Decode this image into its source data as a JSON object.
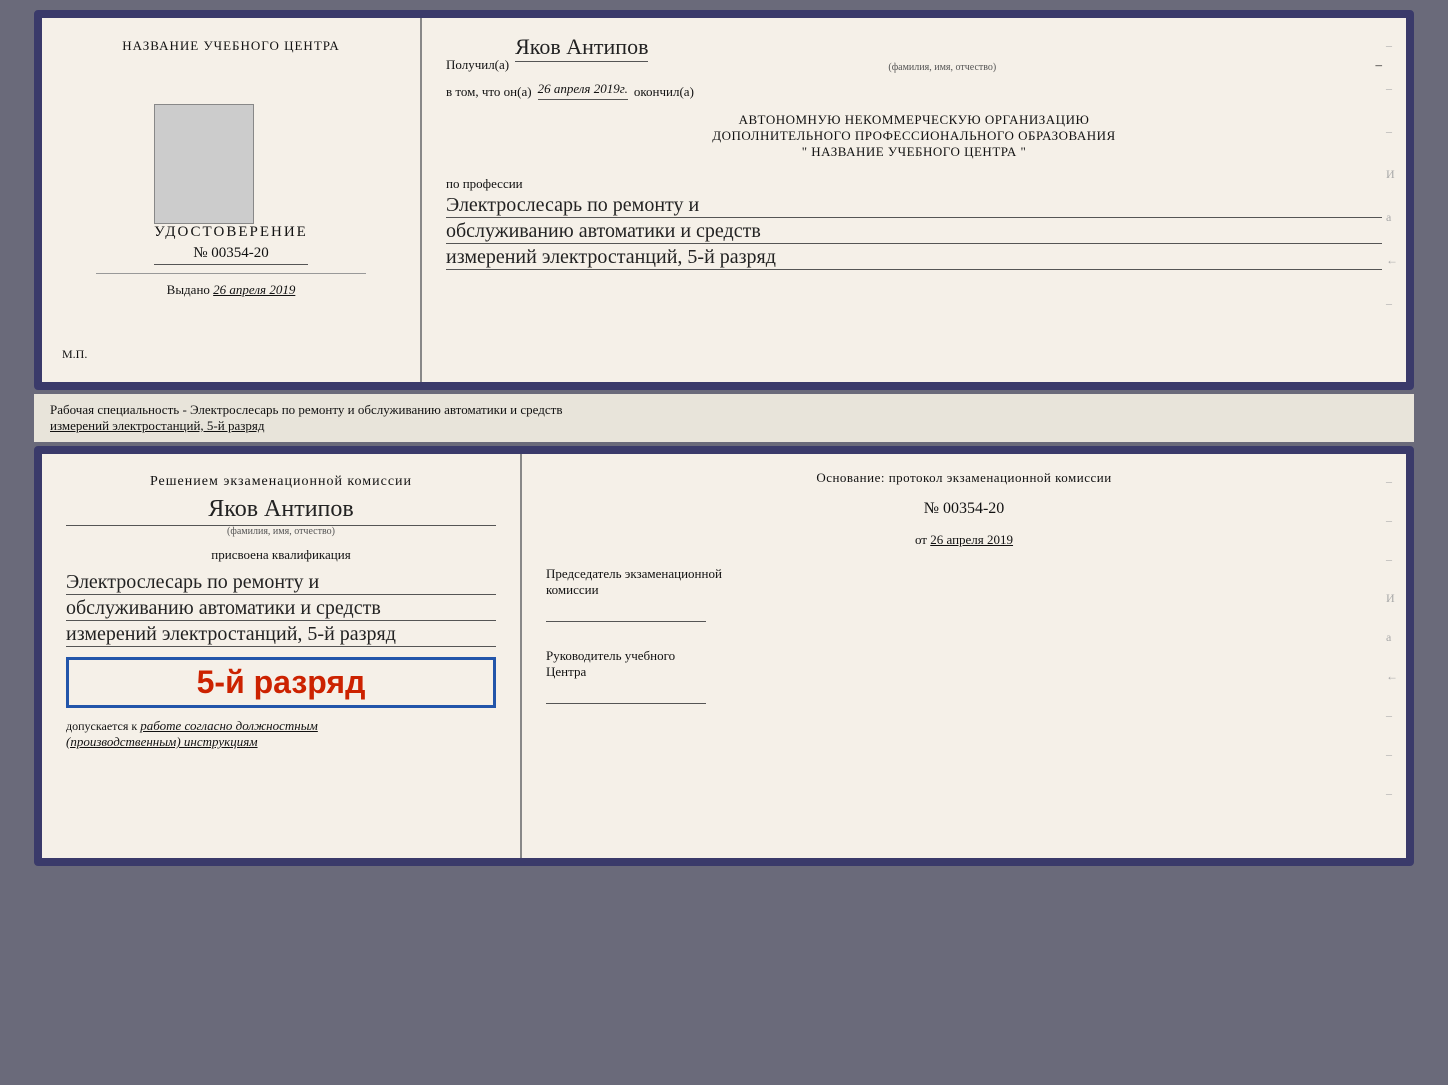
{
  "top_doc": {
    "left": {
      "center_label": "НАЗВАНИЕ УЧЕБНОГО ЦЕНТРА",
      "photo_alt": "photo",
      "udostoverenie": "УДОСТОВЕРЕНИЕ",
      "number": "№ 00354-20",
      "vydano": "Выдано",
      "vydano_date": "26 апреля 2019",
      "mp": "М.П."
    },
    "right": {
      "poluchil": "Получил(а)",
      "recipient_name": "Яков Антипов",
      "fio_label": "(фамилия, имя, отчество)",
      "vtom": "в том, что он(а)",
      "date": "26 апреля 2019г.",
      "okончil": "окончил(а)",
      "org_line1": "АВТОНОМНУЮ НЕКОММЕРЧЕСКУЮ ОРГАНИЗАЦИЮ",
      "org_line2": "ДОПОЛНИТЕЛЬНОГО ПРОФЕССИОНАЛЬНОГО ОБРАЗОВАНИЯ",
      "org_line3": "\"    НАЗВАНИЕ УЧЕБНОГО ЦЕНТРА    \"",
      "po_professii": "по профессии",
      "prof_line1": "Электрослесарь по ремонту и",
      "prof_line2": "обслуживанию автоматики и средств",
      "prof_line3": "измерений электростанций, 5-й разряд",
      "side_dashes": [
        "-",
        "-",
        "-",
        "И",
        "а",
        "←",
        "-"
      ]
    }
  },
  "separator": {
    "text1": "Рабочая специальность - Электрослесарь по ремонту и обслуживанию автоматики и средств",
    "text2": "измерений электростанций, 5-й разряд"
  },
  "bottom_doc": {
    "left": {
      "komissia_title": "Решением экзаменационной комиссии",
      "person_name": "Яков Антипов",
      "fio_label": "(фамилия, имя, отчество)",
      "prisvoena": "присвоена квалификация",
      "qual_line1": "Электрослесарь по ремонту и",
      "qual_line2": "обслуживанию автоматики и средств",
      "qual_line3": "измерений электростанций, 5-й разряд",
      "razryad_badge": "5-й разряд",
      "dopuskaetsya": "допускается к",
      "dopuskaetsya_italic": "работе согласно должностным",
      "instruktsii": "(производственным) инструкциям"
    },
    "right": {
      "osnovanie": "Основание: протокол экзаменационной комиссии",
      "protocol_number": "№  00354-20",
      "ot": "от",
      "ot_date": "26 апреля 2019",
      "predsedatel_title": "Председатель экзаменационной",
      "predsedatel_title2": "комиссии",
      "rukovoditel_title": "Руководитель учебного",
      "rukovoditel_title2": "Центра",
      "side_dashes": [
        "-",
        "-",
        "-",
        "И",
        "а",
        "←",
        "-",
        "-",
        "-"
      ]
    }
  }
}
